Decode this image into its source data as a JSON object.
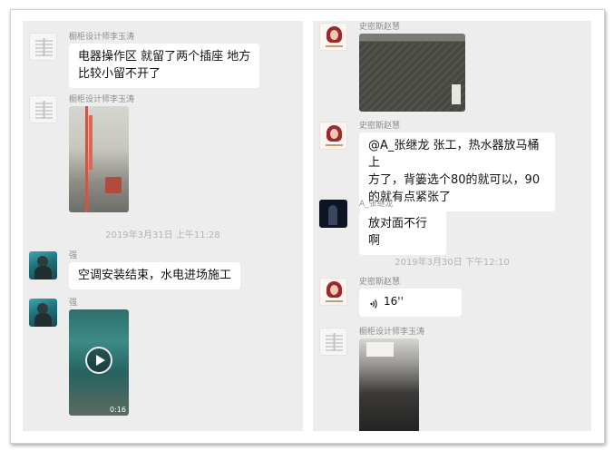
{
  "left_panel": {
    "messages": [
      {
        "sender": "橱柜设计师李玉涛",
        "text_lines": [
          "电器操作区 就留了两个插座 地方",
          "比较小留不开了"
        ]
      },
      {
        "sender": "橱柜设计师李玉涛",
        "attachment": "photo"
      },
      {
        "timestamp": "2019年3月31日 上午11:28"
      },
      {
        "sender": "强",
        "text": "空调安装结束，水电进场施工"
      },
      {
        "sender": "强",
        "attachment": "video",
        "duration": "0:16"
      }
    ]
  },
  "right_panel": {
    "messages": [
      {
        "sender": "史密斯赵慧",
        "attachment": "photo"
      },
      {
        "sender": "史密斯赵慧",
        "text_lines": [
          "@A_张继龙 张工，热水器放马桶上",
          "方了，背篓选个80的就可以，90",
          "的就有点紧张了"
        ]
      },
      {
        "sender": "A_张继龙",
        "text": "放对面不行啊"
      },
      {
        "timestamp": "2019年3月30日 下午12:10"
      },
      {
        "sender": "史密斯赵慧",
        "voice_duration": "16''"
      },
      {
        "sender": "橱柜设计师李玉涛",
        "attachment": "photo"
      }
    ]
  },
  "colors": {
    "chat_background": "#ededed",
    "bubble": "#ffffff",
    "sender_name": "#8c8c8c",
    "timestamp": "#b3b3b3"
  }
}
